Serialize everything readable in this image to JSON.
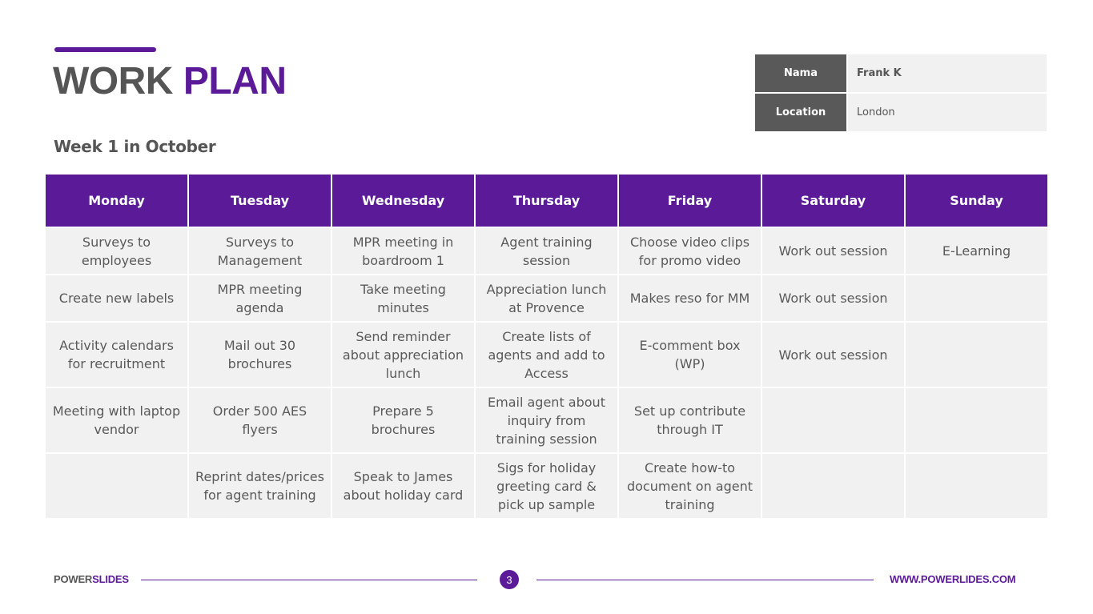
{
  "title": {
    "part1": "WORK",
    "part2": "PLAN"
  },
  "subtitle": "Week 1 in October",
  "info": {
    "name_label": "Nama",
    "name_value": "Frank K",
    "location_label": "Location",
    "location_value": "London"
  },
  "plan": {
    "headers": [
      "Monday",
      "Tuesday",
      "Wednesday",
      "Thursday",
      "Friday",
      "Saturday",
      "Sunday"
    ],
    "rows": [
      [
        "Surveys to employees",
        "Surveys to Management",
        "MPR meeting in boardroom 1",
        "Agent training session",
        "Choose video clips for promo video",
        "Work out session",
        "E-Learning"
      ],
      [
        "Create new labels",
        "MPR meeting agenda",
        "Take meeting minutes",
        "Appreciation lunch at Provence",
        "Makes reso for MM",
        "Work out session",
        ""
      ],
      [
        "Activity calendars for recruitment",
        "Mail out 30 brochures",
        "Send reminder about appreciation lunch",
        "Create lists of agents and add to Access",
        "E-comment box (WP)",
        "Work out session",
        ""
      ],
      [
        "Meeting with laptop vendor",
        "Order 500 AES flyers",
        "Prepare 5 brochures",
        "Email agent about inquiry from training session",
        "Set up contribute through IT",
        "",
        ""
      ],
      [
        "",
        "Reprint dates/prices for agent training",
        "Speak to James about holiday card",
        "Sigs for holiday greeting card & pick up sample",
        "Create how-to document on agent training",
        "",
        ""
      ]
    ]
  },
  "footer": {
    "brand_part1": "POWER",
    "brand_part2": "SLIDES",
    "page_number": "3",
    "url": "WWW.POWERLIDES.COM"
  },
  "colors": {
    "accent": "#5b1a98",
    "dark_gray": "#595959",
    "cell_bg": "#f1f1f1",
    "text": "#555555"
  }
}
